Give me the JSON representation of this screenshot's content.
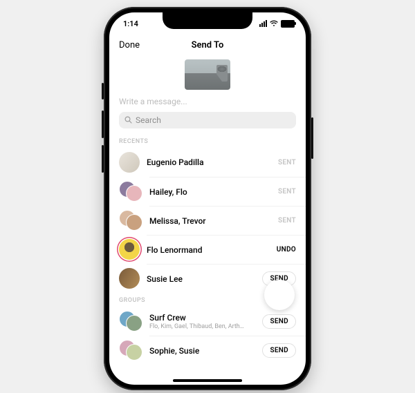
{
  "status": {
    "time": "1:14"
  },
  "nav": {
    "done": "Done",
    "title": "Send To"
  },
  "compose": {
    "message_placeholder": "Write a message..."
  },
  "search": {
    "placeholder": "Search"
  },
  "sections": {
    "recents": "RECENTS",
    "groups": "GROUPS"
  },
  "actions": {
    "sent": "SENT",
    "undo": "UNDO",
    "send": "SEND"
  },
  "recents": [
    {
      "name": "Eugenio Padilla",
      "action": "sent"
    },
    {
      "name": "Hailey, Flo",
      "action": "sent"
    },
    {
      "name": "Melissa, Trevor",
      "action": "sent"
    },
    {
      "name": "Flo Lenormand",
      "action": "undo"
    },
    {
      "name": "Susie Lee",
      "action": "send"
    }
  ],
  "groups": [
    {
      "name": "Surf Crew",
      "members": "Flo, Kim, Gael, Thibaud, Ben, Arth…",
      "action": "send"
    },
    {
      "name": "Sophie, Susie",
      "action": "send"
    }
  ]
}
